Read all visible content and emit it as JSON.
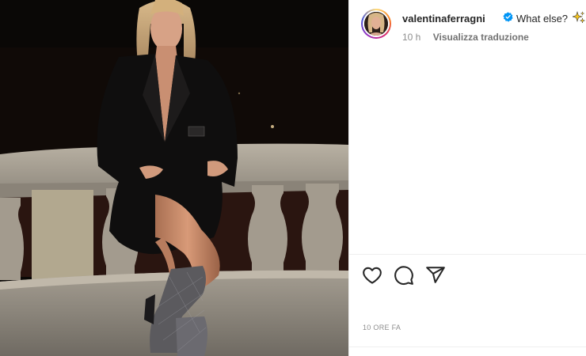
{
  "post": {
    "image_alt": "photo",
    "author": {
      "username": "valentinaferragni",
      "verified": true,
      "avatar": "avatar-photo"
    },
    "caption": {
      "text": "What else?",
      "emoji": "sparkles",
      "mention_start": "@"
    },
    "time_ago": "10 h",
    "translate_label": "Visualizza traduzione",
    "actions": [
      {
        "name": "like",
        "icon": "heart-icon"
      },
      {
        "name": "comment",
        "icon": "comment-icon"
      },
      {
        "name": "share",
        "icon": "paper-plane-icon"
      }
    ],
    "date_label": "10 ORE FA"
  },
  "colors": {
    "verified_blue": "#0095f6",
    "text_primary": "#262626",
    "text_secondary": "#8e8e8e",
    "link": "#00376b"
  }
}
